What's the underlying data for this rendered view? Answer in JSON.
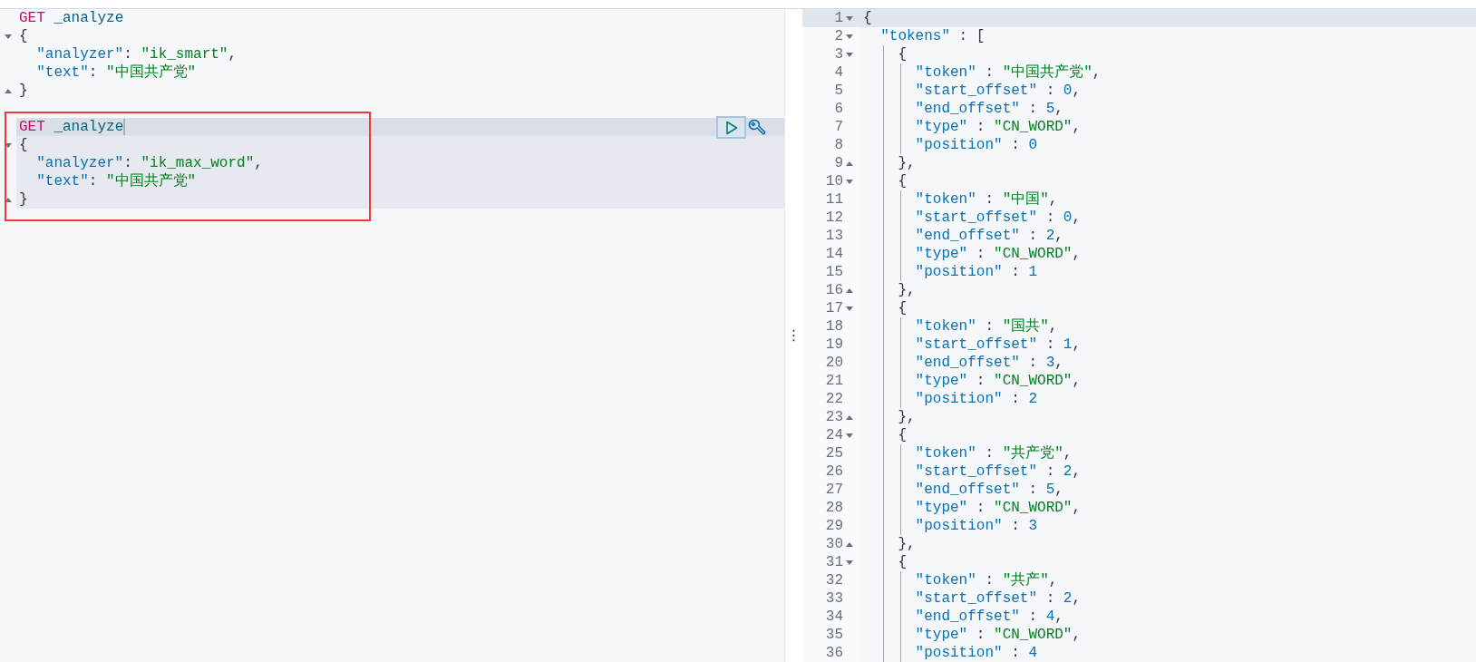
{
  "request_editor": {
    "requests": [
      {
        "selected": false,
        "annotated": false,
        "lines": [
          {
            "cursor": false,
            "kind": "plain",
            "tokens": [
              {
                "kind": "method",
                "text": "GET"
              },
              {
                "kind": "path",
                "text": " _analyze"
              }
            ]
          },
          {
            "cursor": false,
            "kind": "opener",
            "tokens": [
              {
                "kind": "punct",
                "text": "{"
              }
            ]
          },
          {
            "cursor": false,
            "kind": "plain",
            "tokens": [
              {
                "kind": "key",
                "text": "  \"analyzer\""
              },
              {
                "kind": "punct",
                "text": ": "
              },
              {
                "kind": "string",
                "text": "\"ik_smart\""
              },
              {
                "kind": "punct",
                "text": ","
              }
            ]
          },
          {
            "cursor": false,
            "kind": "plain",
            "tokens": [
              {
                "kind": "key",
                "text": "  \"text\""
              },
              {
                "kind": "punct",
                "text": ": "
              },
              {
                "kind": "string",
                "text": "\"中国共产党\""
              }
            ]
          },
          {
            "cursor": false,
            "kind": "closer",
            "tokens": [
              {
                "kind": "punct",
                "text": "}"
              }
            ]
          }
        ]
      },
      {
        "selected": true,
        "annotated": true,
        "lines": [
          {
            "cursor": true,
            "kind": "plain",
            "tokens": [
              {
                "kind": "method",
                "text": "GET"
              },
              {
                "kind": "path",
                "text": " _analyze"
              }
            ]
          },
          {
            "cursor": false,
            "kind": "opener",
            "tokens": [
              {
                "kind": "punct",
                "text": "{"
              }
            ]
          },
          {
            "cursor": false,
            "kind": "plain",
            "tokens": [
              {
                "kind": "key",
                "text": "  \"analyzer\""
              },
              {
                "kind": "punct",
                "text": ": "
              },
              {
                "kind": "string",
                "text": "\"ik_max_word\""
              },
              {
                "kind": "punct",
                "text": ","
              }
            ]
          },
          {
            "cursor": false,
            "kind": "plain",
            "tokens": [
              {
                "kind": "key",
                "text": "  \"text\""
              },
              {
                "kind": "punct",
                "text": ": "
              },
              {
                "kind": "string",
                "text": "\"中国共产党\""
              }
            ]
          },
          {
            "cursor": false,
            "kind": "closer",
            "tokens": [
              {
                "kind": "punct",
                "text": "}"
              }
            ]
          }
        ]
      }
    ]
  },
  "resize_handle": "⋮",
  "response_viewer": {
    "lines": [
      {
        "number": "1",
        "cursor": true,
        "kind": "opener",
        "tokens": [
          {
            "kind": "punct",
            "text": "{"
          }
        ]
      },
      {
        "number": "2",
        "cursor": false,
        "kind": "opener",
        "tokens": [
          {
            "kind": "key",
            "text": "  \"tokens\""
          },
          {
            "kind": "punct",
            "text": " : ["
          }
        ]
      },
      {
        "number": "3",
        "cursor": false,
        "kind": "opener",
        "tokens": [
          {
            "kind": "punct",
            "text": "    {"
          }
        ]
      },
      {
        "number": "4",
        "cursor": false,
        "kind": "plain",
        "tokens": [
          {
            "kind": "key",
            "text": "      \"token\""
          },
          {
            "kind": "punct",
            "text": " : "
          },
          {
            "kind": "string",
            "text": "\"中国共产党\""
          },
          {
            "kind": "punct",
            "text": ","
          }
        ]
      },
      {
        "number": "5",
        "cursor": false,
        "kind": "plain",
        "tokens": [
          {
            "kind": "key",
            "text": "      \"start_offset\""
          },
          {
            "kind": "punct",
            "text": " : "
          },
          {
            "kind": "number",
            "text": "0"
          },
          {
            "kind": "punct",
            "text": ","
          }
        ]
      },
      {
        "number": "6",
        "cursor": false,
        "kind": "plain",
        "tokens": [
          {
            "kind": "key",
            "text": "      \"end_offset\""
          },
          {
            "kind": "punct",
            "text": " : "
          },
          {
            "kind": "number",
            "text": "5"
          },
          {
            "kind": "punct",
            "text": ","
          }
        ]
      },
      {
        "number": "7",
        "cursor": false,
        "kind": "plain",
        "tokens": [
          {
            "kind": "key",
            "text": "      \"type\""
          },
          {
            "kind": "punct",
            "text": " : "
          },
          {
            "kind": "string",
            "text": "\"CN_WORD\""
          },
          {
            "kind": "punct",
            "text": ","
          }
        ]
      },
      {
        "number": "8",
        "cursor": false,
        "kind": "plain",
        "tokens": [
          {
            "kind": "key",
            "text": "      \"position\""
          },
          {
            "kind": "punct",
            "text": " : "
          },
          {
            "kind": "number",
            "text": "0"
          }
        ]
      },
      {
        "number": "9",
        "cursor": false,
        "kind": "closer",
        "tokens": [
          {
            "kind": "punct",
            "text": "    },"
          }
        ]
      },
      {
        "number": "10",
        "cursor": false,
        "kind": "opener",
        "tokens": [
          {
            "kind": "punct",
            "text": "    {"
          }
        ]
      },
      {
        "number": "11",
        "cursor": false,
        "kind": "plain",
        "tokens": [
          {
            "kind": "key",
            "text": "      \"token\""
          },
          {
            "kind": "punct",
            "text": " : "
          },
          {
            "kind": "string",
            "text": "\"中国\""
          },
          {
            "kind": "punct",
            "text": ","
          }
        ]
      },
      {
        "number": "12",
        "cursor": false,
        "kind": "plain",
        "tokens": [
          {
            "kind": "key",
            "text": "      \"start_offset\""
          },
          {
            "kind": "punct",
            "text": " : "
          },
          {
            "kind": "number",
            "text": "0"
          },
          {
            "kind": "punct",
            "text": ","
          }
        ]
      },
      {
        "number": "13",
        "cursor": false,
        "kind": "plain",
        "tokens": [
          {
            "kind": "key",
            "text": "      \"end_offset\""
          },
          {
            "kind": "punct",
            "text": " : "
          },
          {
            "kind": "number",
            "text": "2"
          },
          {
            "kind": "punct",
            "text": ","
          }
        ]
      },
      {
        "number": "14",
        "cursor": false,
        "kind": "plain",
        "tokens": [
          {
            "kind": "key",
            "text": "      \"type\""
          },
          {
            "kind": "punct",
            "text": " : "
          },
          {
            "kind": "string",
            "text": "\"CN_WORD\""
          },
          {
            "kind": "punct",
            "text": ","
          }
        ]
      },
      {
        "number": "15",
        "cursor": false,
        "kind": "plain",
        "tokens": [
          {
            "kind": "key",
            "text": "      \"position\""
          },
          {
            "kind": "punct",
            "text": " : "
          },
          {
            "kind": "number",
            "text": "1"
          }
        ]
      },
      {
        "number": "16",
        "cursor": false,
        "kind": "closer",
        "tokens": [
          {
            "kind": "punct",
            "text": "    },"
          }
        ]
      },
      {
        "number": "17",
        "cursor": false,
        "kind": "opener",
        "tokens": [
          {
            "kind": "punct",
            "text": "    {"
          }
        ]
      },
      {
        "number": "18",
        "cursor": false,
        "kind": "plain",
        "tokens": [
          {
            "kind": "key",
            "text": "      \"token\""
          },
          {
            "kind": "punct",
            "text": " : "
          },
          {
            "kind": "string",
            "text": "\"国共\""
          },
          {
            "kind": "punct",
            "text": ","
          }
        ]
      },
      {
        "number": "19",
        "cursor": false,
        "kind": "plain",
        "tokens": [
          {
            "kind": "key",
            "text": "      \"start_offset\""
          },
          {
            "kind": "punct",
            "text": " : "
          },
          {
            "kind": "number",
            "text": "1"
          },
          {
            "kind": "punct",
            "text": ","
          }
        ]
      },
      {
        "number": "20",
        "cursor": false,
        "kind": "plain",
        "tokens": [
          {
            "kind": "key",
            "text": "      \"end_offset\""
          },
          {
            "kind": "punct",
            "text": " : "
          },
          {
            "kind": "number",
            "text": "3"
          },
          {
            "kind": "punct",
            "text": ","
          }
        ]
      },
      {
        "number": "21",
        "cursor": false,
        "kind": "plain",
        "tokens": [
          {
            "kind": "key",
            "text": "      \"type\""
          },
          {
            "kind": "punct",
            "text": " : "
          },
          {
            "kind": "string",
            "text": "\"CN_WORD\""
          },
          {
            "kind": "punct",
            "text": ","
          }
        ]
      },
      {
        "number": "22",
        "cursor": false,
        "kind": "plain",
        "tokens": [
          {
            "kind": "key",
            "text": "      \"position\""
          },
          {
            "kind": "punct",
            "text": " : "
          },
          {
            "kind": "number",
            "text": "2"
          }
        ]
      },
      {
        "number": "23",
        "cursor": false,
        "kind": "closer",
        "tokens": [
          {
            "kind": "punct",
            "text": "    },"
          }
        ]
      },
      {
        "number": "24",
        "cursor": false,
        "kind": "opener",
        "tokens": [
          {
            "kind": "punct",
            "text": "    {"
          }
        ]
      },
      {
        "number": "25",
        "cursor": false,
        "kind": "plain",
        "tokens": [
          {
            "kind": "key",
            "text": "      \"token\""
          },
          {
            "kind": "punct",
            "text": " : "
          },
          {
            "kind": "string",
            "text": "\"共产党\""
          },
          {
            "kind": "punct",
            "text": ","
          }
        ]
      },
      {
        "number": "26",
        "cursor": false,
        "kind": "plain",
        "tokens": [
          {
            "kind": "key",
            "text": "      \"start_offset\""
          },
          {
            "kind": "punct",
            "text": " : "
          },
          {
            "kind": "number",
            "text": "2"
          },
          {
            "kind": "punct",
            "text": ","
          }
        ]
      },
      {
        "number": "27",
        "cursor": false,
        "kind": "plain",
        "tokens": [
          {
            "kind": "key",
            "text": "      \"end_offset\""
          },
          {
            "kind": "punct",
            "text": " : "
          },
          {
            "kind": "number",
            "text": "5"
          },
          {
            "kind": "punct",
            "text": ","
          }
        ]
      },
      {
        "number": "28",
        "cursor": false,
        "kind": "plain",
        "tokens": [
          {
            "kind": "key",
            "text": "      \"type\""
          },
          {
            "kind": "punct",
            "text": " : "
          },
          {
            "kind": "string",
            "text": "\"CN_WORD\""
          },
          {
            "kind": "punct",
            "text": ","
          }
        ]
      },
      {
        "number": "29",
        "cursor": false,
        "kind": "plain",
        "tokens": [
          {
            "kind": "key",
            "text": "      \"position\""
          },
          {
            "kind": "punct",
            "text": " : "
          },
          {
            "kind": "number",
            "text": "3"
          }
        ]
      },
      {
        "number": "30",
        "cursor": false,
        "kind": "closer",
        "tokens": [
          {
            "kind": "punct",
            "text": "    },"
          }
        ]
      },
      {
        "number": "31",
        "cursor": false,
        "kind": "opener",
        "tokens": [
          {
            "kind": "punct",
            "text": "    {"
          }
        ]
      },
      {
        "number": "32",
        "cursor": false,
        "kind": "plain",
        "tokens": [
          {
            "kind": "key",
            "text": "      \"token\""
          },
          {
            "kind": "punct",
            "text": " : "
          },
          {
            "kind": "string",
            "text": "\"共产\""
          },
          {
            "kind": "punct",
            "text": ","
          }
        ]
      },
      {
        "number": "33",
        "cursor": false,
        "kind": "plain",
        "tokens": [
          {
            "kind": "key",
            "text": "      \"start_offset\""
          },
          {
            "kind": "punct",
            "text": " : "
          },
          {
            "kind": "number",
            "text": "2"
          },
          {
            "kind": "punct",
            "text": ","
          }
        ]
      },
      {
        "number": "34",
        "cursor": false,
        "kind": "plain",
        "tokens": [
          {
            "kind": "key",
            "text": "      \"end_offset\""
          },
          {
            "kind": "punct",
            "text": " : "
          },
          {
            "kind": "number",
            "text": "4"
          },
          {
            "kind": "punct",
            "text": ","
          }
        ]
      },
      {
        "number": "35",
        "cursor": false,
        "kind": "plain",
        "tokens": [
          {
            "kind": "key",
            "text": "      \"type\""
          },
          {
            "kind": "punct",
            "text": " : "
          },
          {
            "kind": "string",
            "text": "\"CN_WORD\""
          },
          {
            "kind": "punct",
            "text": ","
          }
        ]
      },
      {
        "number": "36",
        "cursor": false,
        "kind": "plain",
        "tokens": [
          {
            "kind": "key",
            "text": "      \"position\""
          },
          {
            "kind": "punct",
            "text": " : "
          },
          {
            "kind": "number",
            "text": "4"
          }
        ]
      }
    ]
  }
}
